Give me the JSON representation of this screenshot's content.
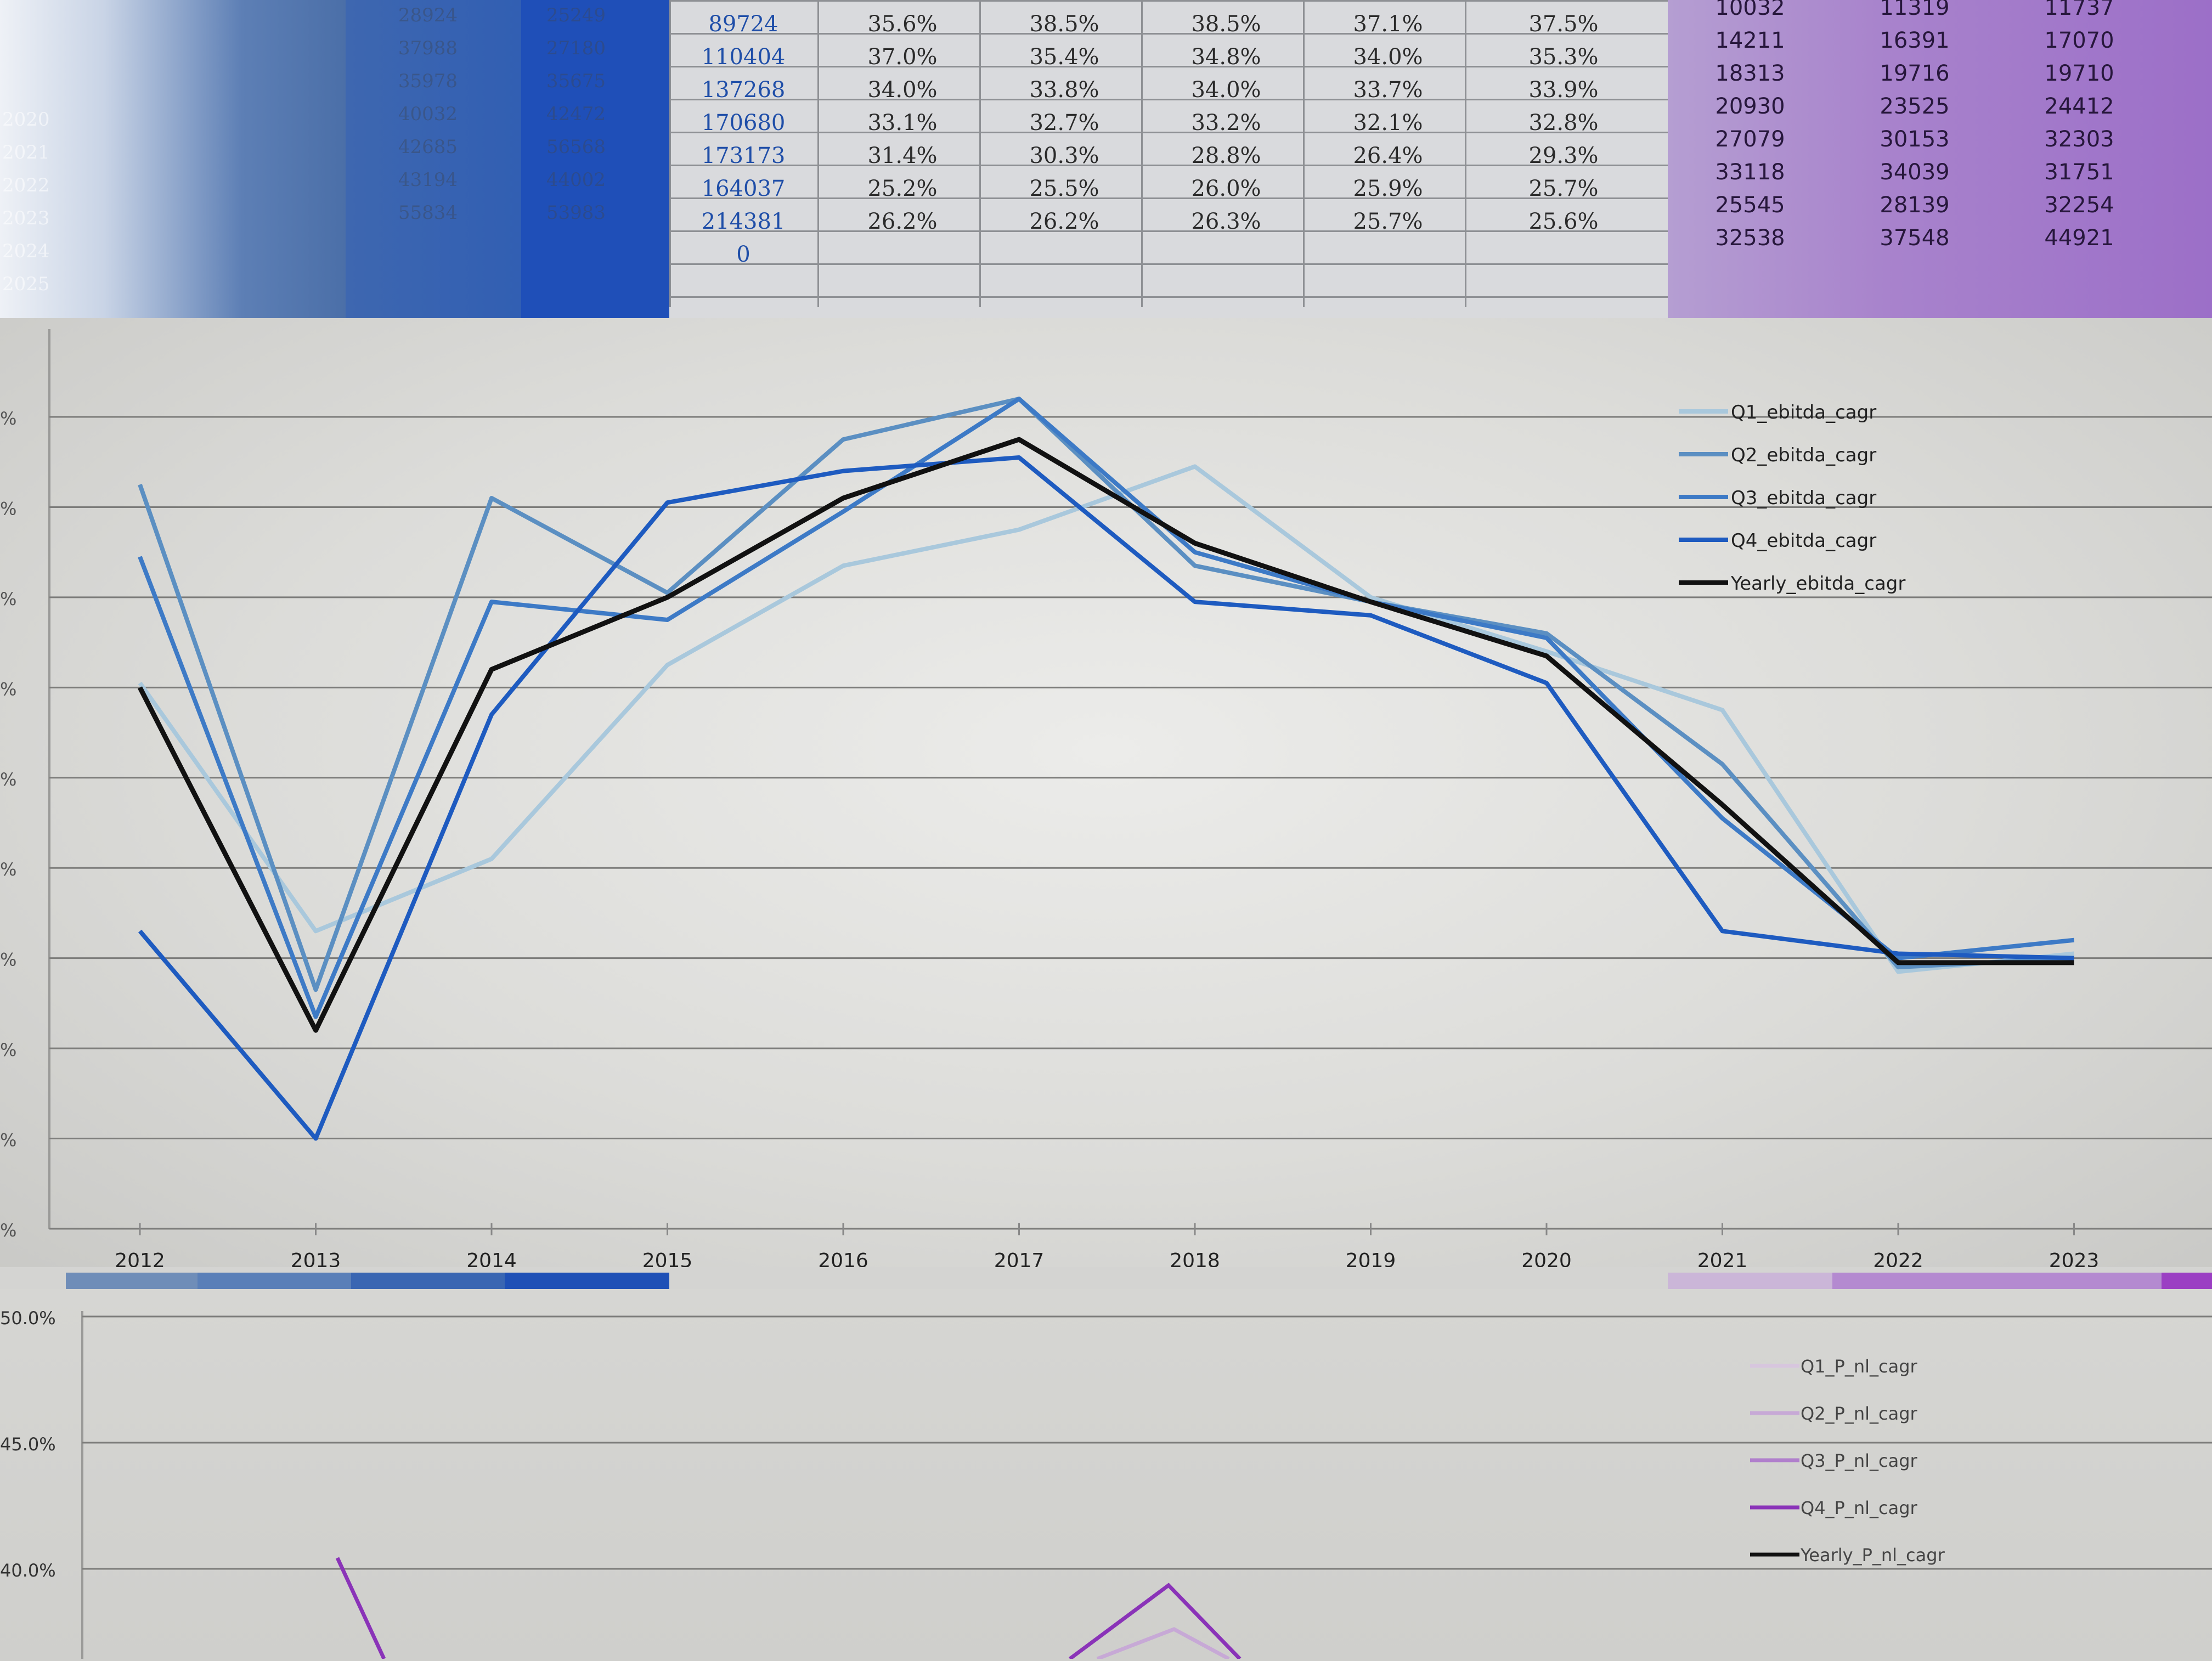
{
  "sheet": {
    "row_labels": [
      "2020",
      "2021",
      "2022",
      "2023",
      "2024",
      "2025"
    ],
    "left_faint_cols": [
      [
        "28924",
        "37988",
        "35978",
        "40032",
        "42685",
        "43194",
        "55834"
      ],
      [
        "25249",
        "27180",
        "35675",
        "42472",
        "56568",
        "44002",
        "53983"
      ]
    ],
    "revenue_col": [
      "89724",
      "110404",
      "137268",
      "170680",
      "173173",
      "164037",
      "214381",
      "0"
    ],
    "margin_cols": [
      [
        "35.6%",
        "37.0%",
        "34.0%",
        "33.1%",
        "31.4%",
        "25.2%",
        "26.2%"
      ],
      [
        "38.5%",
        "35.4%",
        "33.8%",
        "32.7%",
        "30.3%",
        "25.5%",
        "26.2%"
      ],
      [
        "38.5%",
        "34.8%",
        "34.0%",
        "33.2%",
        "28.8%",
        "26.0%",
        "26.3%"
      ],
      [
        "37.1%",
        "34.0%",
        "33.7%",
        "32.1%",
        "26.4%",
        "25.9%",
        "25.7%"
      ],
      [
        "37.5%",
        "35.3%",
        "33.9%",
        "32.8%",
        "29.3%",
        "25.7%",
        "25.6%"
      ]
    ],
    "purple_cols": [
      [
        "10032",
        "14211",
        "18313",
        "20930",
        "27079",
        "33118",
        "25545",
        "32538"
      ],
      [
        "11319",
        "16391",
        "19716",
        "23525",
        "30153",
        "34039",
        "28139",
        "37548"
      ],
      [
        "11737",
        "17070",
        "19710",
        "24412",
        "32303",
        "31751",
        "32254",
        "44921"
      ]
    ]
  },
  "chart_data": [
    {
      "type": "line",
      "title": "",
      "xlabel": "",
      "ylabel": "",
      "x": [
        "2012",
        "2013",
        "2014",
        "2015",
        "2016",
        "2017",
        "2018",
        "2019",
        "2020",
        "2021",
        "2022",
        "2023"
      ],
      "y_tick_labels": [
        "%",
        "%",
        "%",
        "%",
        "%",
        "%",
        "%",
        "%",
        "%",
        "%"
      ],
      "ylim": [
        0,
        9
      ],
      "grid": true,
      "legend_position": "top-right",
      "series": [
        {
          "name": "Q1_ebitda_cagr",
          "color": "#a9c8dc",
          "values": [
            6.05,
            3.3,
            4.1,
            6.25,
            7.35,
            7.75,
            8.45,
            7.0,
            6.4,
            5.75,
            2.85,
            3.05
          ]
        },
        {
          "name": "Q2_ebitda_cagr",
          "color": "#5b8fc2",
          "values": [
            8.25,
            2.65,
            8.1,
            7.05,
            8.75,
            9.2,
            7.35,
            6.95,
            6.6,
            5.15,
            2.9,
            3.0
          ]
        },
        {
          "name": "Q3_ebitda_cagr",
          "color": "#3d7ac6",
          "values": [
            7.45,
            2.35,
            6.95,
            6.75,
            7.95,
            9.2,
            7.5,
            6.95,
            6.55,
            4.55,
            3.0,
            3.2
          ]
        },
        {
          "name": "Q4_ebitda_cagr",
          "color": "#1e5bc0",
          "values": [
            3.3,
            1.0,
            5.7,
            8.05,
            8.4,
            8.55,
            6.95,
            6.8,
            6.05,
            3.3,
            3.05,
            3.0
          ]
        },
        {
          "name": "Yearly_ebitda_cagr",
          "color": "#111111",
          "values": [
            6.0,
            2.2,
            6.2,
            7.0,
            8.1,
            8.75,
            7.6,
            6.95,
            6.35,
            4.7,
            2.95,
            2.95
          ]
        }
      ]
    },
    {
      "type": "line",
      "title": "",
      "xlabel": "",
      "ylabel": "",
      "y_tick_labels": [
        "50.0%",
        "45.0%",
        "40.0%"
      ],
      "ylim": [
        0.38,
        0.5
      ],
      "grid": true,
      "legend_position": "top-right",
      "series": [
        {
          "name": "Q1_P_nl_cagr",
          "color": "#d7c6de"
        },
        {
          "name": "Q2_P_nl_cagr",
          "color": "#c7a9d6"
        },
        {
          "name": "Q3_P_nl_cagr",
          "color": "#b07fcc"
        },
        {
          "name": "Q4_P_nl_cagr",
          "color": "#8a33b8"
        },
        {
          "name": "Yearly_P_nl_cagr",
          "color": "#111111"
        }
      ]
    }
  ]
}
